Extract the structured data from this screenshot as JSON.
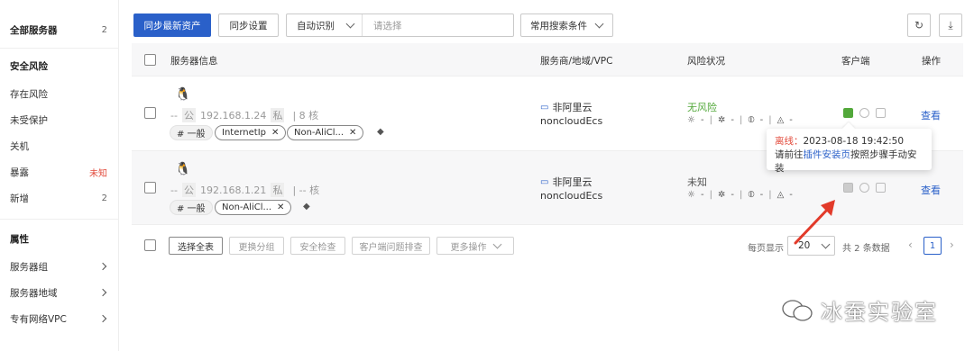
{
  "sidebar": {
    "all_servers": {
      "label": "全部服务器",
      "count": "2"
    },
    "security_risk": {
      "title": "安全风险",
      "items": [
        {
          "label": "存在风险",
          "count": ""
        },
        {
          "label": "未受保护",
          "count": ""
        },
        {
          "label": "关机",
          "count": ""
        },
        {
          "label": "暴露",
          "count": "未知"
        },
        {
          "label": "新增",
          "count": "2"
        }
      ]
    },
    "attributes": {
      "title": "属性",
      "items": [
        {
          "label": "服务器组"
        },
        {
          "label": "服务器地域"
        },
        {
          "label": "专有网络VPC"
        }
      ]
    }
  },
  "toolbar": {
    "sync_assets": "同步最新资产",
    "sync_settings": "同步设置",
    "auto_detect": "自动识别",
    "select_placeholder": "请选择",
    "common_search": "常用搜索条件",
    "refresh_icon": "refresh-icon",
    "download_icon": "download-icon"
  },
  "table": {
    "headers": {
      "server_info": "服务器信息",
      "provider": "服务商/地域/VPC",
      "risk": "风险状况",
      "client": "客户端",
      "action": "操作"
    },
    "rows": [
      {
        "os_icon": "linux-penguin-icon",
        "name": "--",
        "pub_tag": "公",
        "ip": "192.168.1.24",
        "priv_tag": "私",
        "cores": "| 8 核",
        "group_tag": "# 一般",
        "tags": [
          "InternetIp",
          "Non-AliCl..."
        ],
        "provider": "非阿里云",
        "provider_sub": "noncloudEcs",
        "risk_status": "无风险",
        "risk_metrics": [
          "-",
          "-",
          "-",
          "-"
        ],
        "action": "查看"
      },
      {
        "os_icon": "linux-penguin-icon",
        "name": "--",
        "pub_tag": "公",
        "ip": "192.168.1.21",
        "priv_tag": "私",
        "cores": "| -- 核",
        "group_tag": "# 一般",
        "tags": [
          "Non-AliCl..."
        ],
        "provider": "非阿里云",
        "provider_sub": "noncloudEcs",
        "risk_status": "未知",
        "risk_metrics": [
          "-",
          "-",
          "-",
          "-"
        ],
        "action": "查看"
      }
    ]
  },
  "tooltip": {
    "offline_label": "离线：",
    "offline_time": "2023-08-18 19:42:50",
    "prefix": "请前往",
    "link": "插件安装页",
    "suffix": "按照步骤手动安装"
  },
  "footer": {
    "select_all": "选择全表",
    "change_group": "更换分组",
    "security_check": "安全检查",
    "client_troubleshoot": "客户端问题排查",
    "more_actions": "更多操作",
    "per_page_label": "每页显示",
    "per_page": "20",
    "total": "共 2 条数据",
    "current_page": "1"
  },
  "watermark": "冰蚕实验室",
  "colors": {
    "primary": "#2a60c9",
    "safe": "#52a83a",
    "warning_red": "#e24a3b",
    "arrow": "#e23a2a"
  }
}
